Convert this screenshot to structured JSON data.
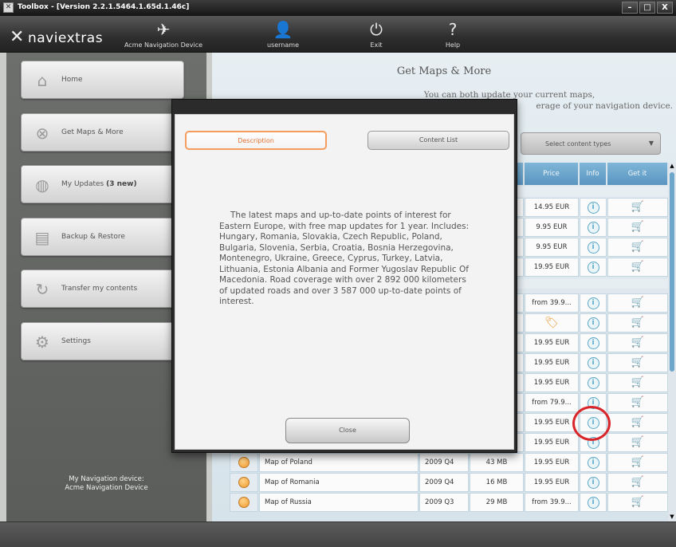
{
  "window": {
    "title": "Toolbox - [Version 2.2.1.5464.1.65d.1.46c]",
    "buttons": [
      "–",
      "□",
      "X"
    ]
  },
  "toolbar": {
    "logo": "naviextras",
    "device_label": "Acme Navigation Device",
    "user_label": "username",
    "exit_label": "Exit",
    "help_label": "Help"
  },
  "sidebar": {
    "items": [
      {
        "label": "Home",
        "icon": "home-icon"
      },
      {
        "label": "Get Maps & More",
        "icon": "cart-icon"
      },
      {
        "label": "My Updates",
        "badge": "(3 new)",
        "icon": "globe-icon"
      },
      {
        "label": "Backup & Restore",
        "icon": "backup-icon"
      },
      {
        "label": "Transfer my contents",
        "icon": "transfer-icon"
      },
      {
        "label": "Settings",
        "icon": "gear-icon"
      }
    ],
    "device_caption": "My Navigation device:",
    "device_name": "Acme Navigation Device"
  },
  "main": {
    "title": "Get Maps & More",
    "subtitle_line1": "You can both update your current maps,",
    "subtitle_line2": "erage of your navigation device.",
    "select_placeholder": "Select content types",
    "columns": {
      "price": "Price",
      "info": "Info",
      "get": "Get it"
    },
    "price_rows": [
      "14.95 EUR",
      "9.95 EUR",
      "9.95 EUR",
      "19.95 EUR",
      "from 39.9...",
      "",
      "19.95 EUR",
      "19.95 EUR",
      "19.95 EUR",
      "from 79.9...",
      "19.95 EUR",
      "19.95 EUR"
    ],
    "visible_rows": [
      {
        "name": "Map of Poland",
        "release": "2009 Q4",
        "size": "43 MB",
        "price": "19.95 EUR"
      },
      {
        "name": "Map of Romania",
        "release": "2009 Q4",
        "size": "16 MB",
        "price": "19.95 EUR"
      },
      {
        "name": "Map of Russia",
        "release": "2009 Q3",
        "size": "29 MB",
        "price": "from 39.9..."
      }
    ]
  },
  "modal": {
    "tab_description": "Description",
    "tab_content_list": "Content List",
    "description": "The latest maps and up-to-date points of interest for Eastern Europe, with free map updates for 1 year. Includes: Hungary, Romania, Slovakia, Czech Republic, Poland, Bulgaria, Slovenia, Serbia, Croatia, Bosnia Herzegovina, Montenegro, Ukraine, Greece, Cyprus, Turkey, Latvia, Lithuania, Estonia Albania and Former Yugoslav Republic Of Macedonia.   Road coverage with over 2 892 000 kilometers of updated roads and over 3 587 000 up-to-date points of interest.",
    "close_label": "Close"
  },
  "colors": {
    "header_blue": "#6aa6cf",
    "accent_orange": "#f59d5e",
    "highlight_red": "#d8262a"
  }
}
